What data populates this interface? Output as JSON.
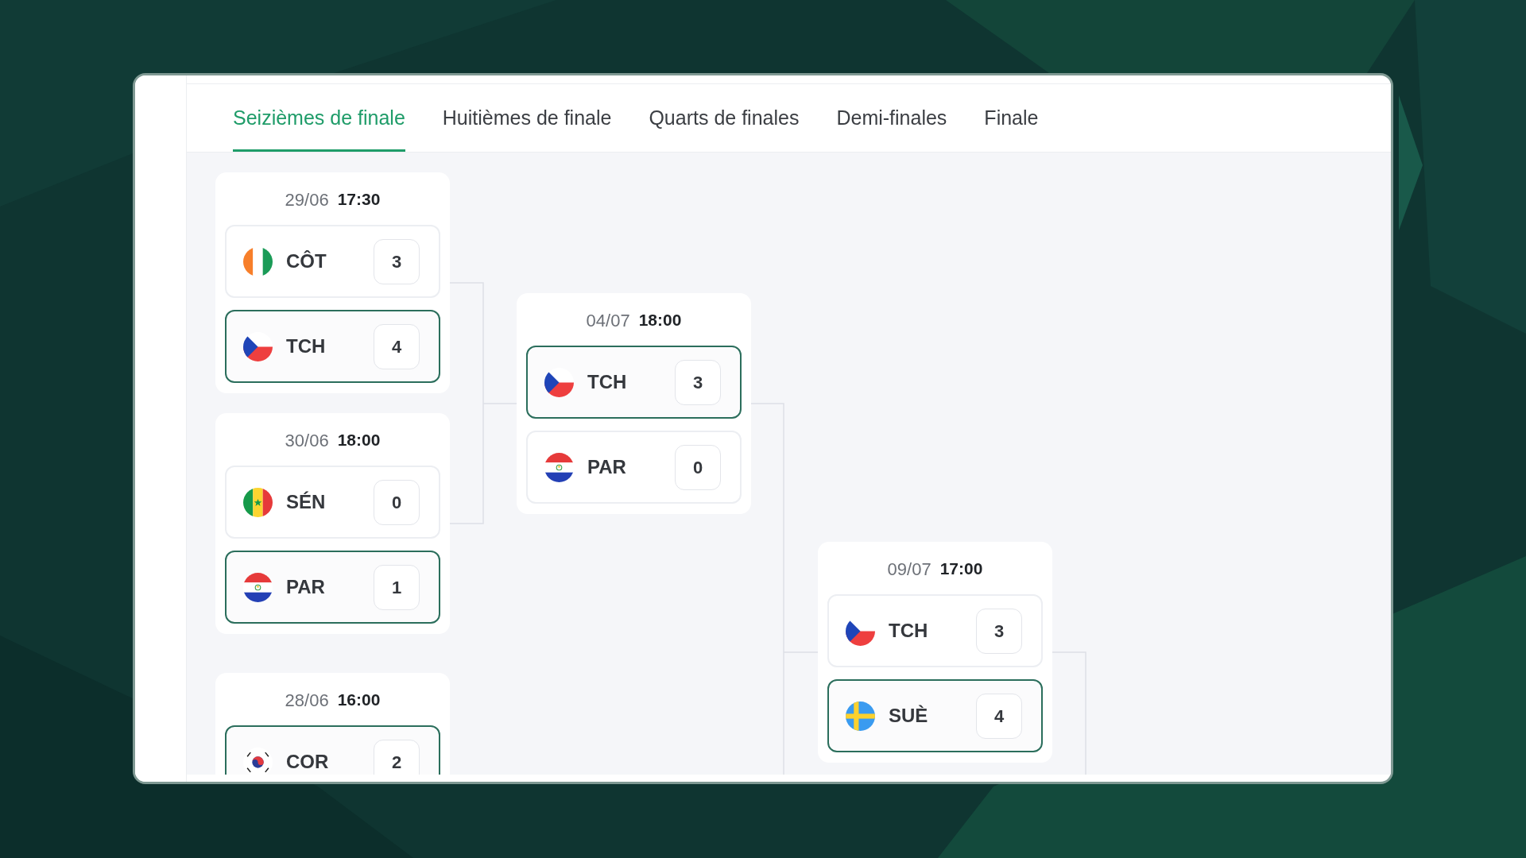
{
  "tabs": [
    {
      "label": "Seizièmes de finale",
      "selected": true
    },
    {
      "label": "Huitièmes de finale",
      "selected": false
    },
    {
      "label": "Quarts de finales",
      "selected": false
    },
    {
      "label": "Demi-finales",
      "selected": false
    },
    {
      "label": "Finale",
      "selected": false
    }
  ],
  "bracket": {
    "rounds": [
      {
        "matches": [
          {
            "date": "29/06",
            "time": "17:30",
            "teams": [
              {
                "kind": "ivorian",
                "name": "CÔT",
                "score": "3",
                "winner": false
              },
              {
                "kind": "czech",
                "name": "TCH",
                "score": "4",
                "winner": true
              }
            ]
          },
          {
            "date": "30/06",
            "time": "18:00",
            "teams": [
              {
                "kind": "senegalese",
                "name": "SÉN",
                "score": "0",
                "winner": false
              },
              {
                "kind": "paraguayan",
                "name": "PAR",
                "score": "1",
                "winner": true
              }
            ]
          },
          {
            "date": "28/06",
            "time": "16:00",
            "teams": [
              {
                "kind": "korean",
                "name": "COR",
                "score": "2",
                "winner": true
              }
            ]
          }
        ]
      },
      {
        "matches": [
          {
            "date": "04/07",
            "time": "18:00",
            "teams": [
              {
                "kind": "czech",
                "name": "TCH",
                "score": "3",
                "winner": true
              },
              {
                "kind": "paraguayan",
                "name": "PAR",
                "score": "0",
                "winner": false
              }
            ]
          }
        ]
      },
      {
        "matches": [
          {
            "date": "09/07",
            "time": "17:00",
            "teams": [
              {
                "kind": "czech",
                "name": "TCH",
                "score": "3",
                "winner": false
              },
              {
                "kind": "swedish",
                "name": "SUÈ",
                "score": "4",
                "winner": true
              }
            ]
          }
        ]
      }
    ]
  }
}
